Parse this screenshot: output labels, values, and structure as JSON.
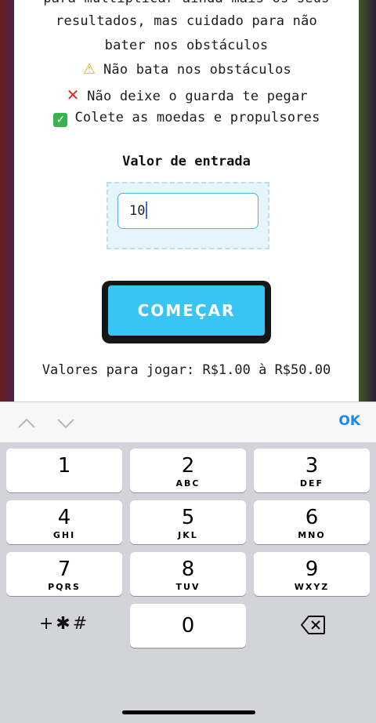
{
  "instructions": {
    "line_top_partial": "para multiplicar ainda mais os seus",
    "line1": "resultados, mas cuidado para não",
    "line2": "bater nos obstáculos",
    "rule1": "Não bata nos obstáculos",
    "rule2": "Não deixe o guarda te pegar",
    "rule3": "Colete as moedas e propulsores"
  },
  "input": {
    "label": "Valor de entrada",
    "value": "10"
  },
  "start_button": {
    "label": "COMEÇAR"
  },
  "values_text": "Valores para jogar: R$1.00 à R$50.00",
  "keyboard": {
    "done_label": "OK",
    "keys": [
      {
        "num": "1",
        "letters": ""
      },
      {
        "num": "2",
        "letters": "ABC"
      },
      {
        "num": "3",
        "letters": "DEF"
      },
      {
        "num": "4",
        "letters": "GHI"
      },
      {
        "num": "5",
        "letters": "JKL"
      },
      {
        "num": "6",
        "letters": "MNO"
      },
      {
        "num": "7",
        "letters": "PQRS"
      },
      {
        "num": "8",
        "letters": "TUV"
      },
      {
        "num": "9",
        "letters": "WXYZ"
      },
      {
        "num": "0",
        "letters": ""
      }
    ],
    "symbols_label": "+✱#"
  },
  "icons": {
    "warning": "warning-icon",
    "cross": "cross-icon",
    "check": "check-icon",
    "backspace": "backspace-icon",
    "up": "chevron-up-icon",
    "down": "chevron-down-icon"
  }
}
